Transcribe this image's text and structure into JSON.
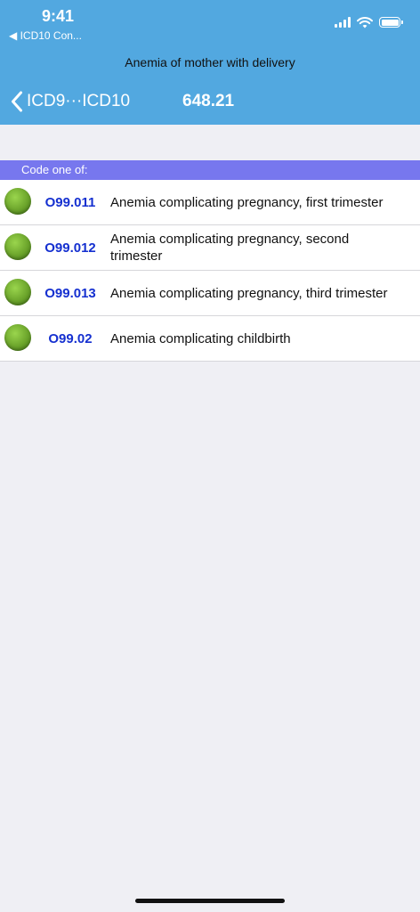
{
  "status_bar": {
    "time": "9:41",
    "back_app": "◀ ICD10 Con..."
  },
  "header": {
    "subtitle": "Anemia of mother with delivery",
    "back_label": "ICD9···ICD10",
    "title": "648.21"
  },
  "section": {
    "label": "Code one of:"
  },
  "codes": [
    {
      "code": "O99.011",
      "description": "Anemia complicating pregnancy, first trimester"
    },
    {
      "code": "O99.012",
      "description": "Anemia complicating pregnancy, second trimester"
    },
    {
      "code": "O99.013",
      "description": "Anemia complicating pregnancy, third trimester"
    },
    {
      "code": "O99.02",
      "description": "Anemia complicating childbirth"
    }
  ],
  "colors": {
    "header_bg": "#52a8e0",
    "section_bg": "#7777ee",
    "code_text": "#1530d0",
    "page_bg": "#efeff4"
  },
  "icons": {
    "status_ball": "green-ball-icon",
    "back": "chevron-left-icon",
    "signal": "cellular-signal-icon",
    "wifi": "wifi-icon",
    "battery": "battery-icon"
  }
}
